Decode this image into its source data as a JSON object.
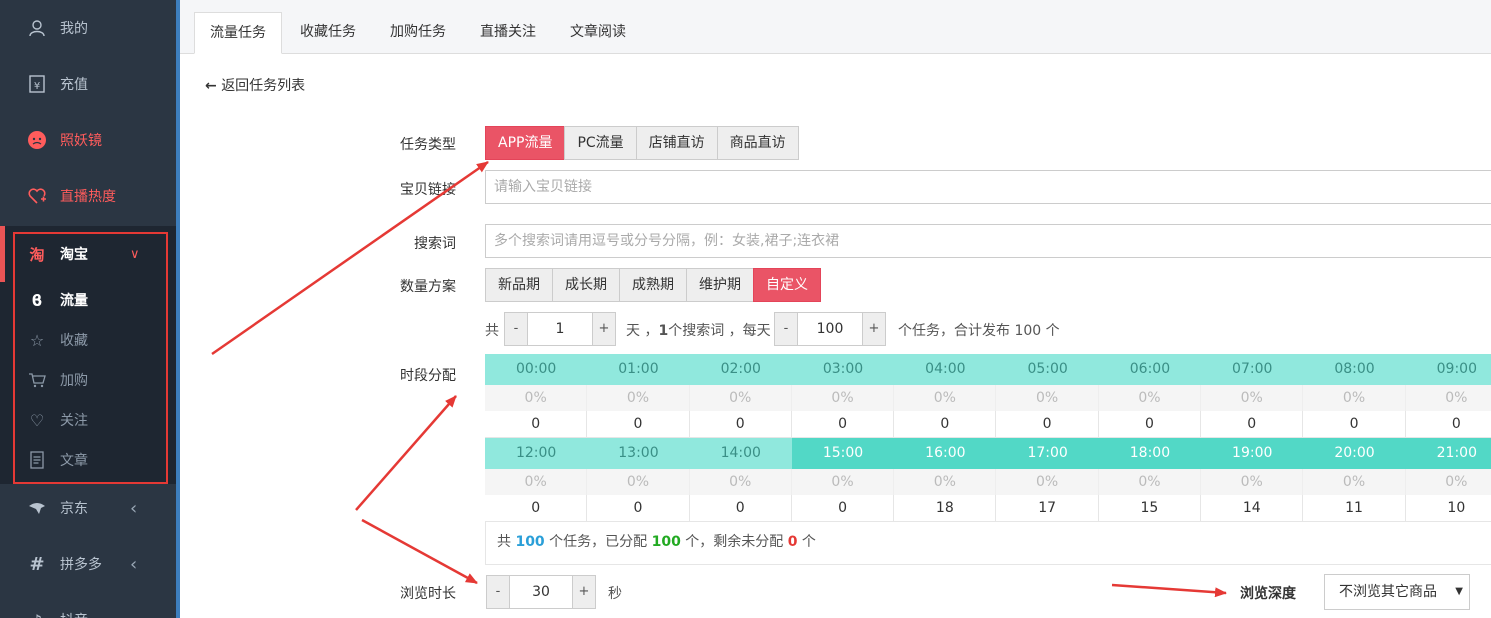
{
  "sidebar": {
    "top_items": [
      {
        "label": "我的",
        "icon": "user-icon"
      },
      {
        "label": "充值",
        "icon": "wallet-icon"
      },
      {
        "label": "照妖镜",
        "icon": "face-icon"
      },
      {
        "label": "直播热度",
        "icon": "heart-plus-icon"
      }
    ],
    "taobao": {
      "label": "淘宝",
      "icon": "taobao-icon",
      "chevron": "∨"
    },
    "sub_items": [
      {
        "label": "流量",
        "icon": "traffic-icon"
      },
      {
        "label": "收藏",
        "icon": "star-icon"
      },
      {
        "label": "加购",
        "icon": "cart-icon"
      },
      {
        "label": "关注",
        "icon": "heart-icon"
      },
      {
        "label": "文章",
        "icon": "article-icon"
      }
    ],
    "bottom_items": [
      {
        "label": "京东",
        "icon": "jd-icon",
        "chevron": "‹"
      },
      {
        "label": "拼多多",
        "icon": "pdd-icon",
        "chevron": "‹"
      },
      {
        "label": "抖音",
        "icon": "douyin-icon"
      }
    ]
  },
  "tabs": [
    "流量任务",
    "收藏任务",
    "加购任务",
    "直播关注",
    "文章阅读"
  ],
  "back_label": "返回任务列表",
  "form": {
    "task_type_label": "任务类型",
    "task_types": [
      "APP流量",
      "PC流量",
      "店铺直访",
      "商品直访"
    ],
    "link_label": "宝贝链接",
    "link_placeholder": "请输入宝贝链接",
    "keyword_label": "搜索词",
    "keyword_placeholder": "多个搜索词请用逗号或分号分隔，例：女装,裙子;连衣裙",
    "qty_label": "数量方案",
    "qty_plans": [
      "新品期",
      "成长期",
      "成熟期",
      "维护期",
      "自定义"
    ],
    "plan_text_1": "共",
    "days_value": "1",
    "plan_text_2": "天 ，",
    "plan_text_3": "1",
    "plan_text_4": "个搜索词 ，每天",
    "per_day_value": "100",
    "plan_text_5": "个任务，合计发布 100 个",
    "minus": "-",
    "plus": "+",
    "time_label": "时段分配",
    "time_rows": [
      {
        "hours": [
          "00:00",
          "01:00",
          "02:00",
          "03:00",
          "04:00",
          "05:00",
          "06:00",
          "07:00",
          "08:00",
          "09:00"
        ],
        "pcts": [
          "0%",
          "0%",
          "0%",
          "0%",
          "0%",
          "0%",
          "0%",
          "0%",
          "0%",
          "0%"
        ],
        "nums": [
          "0",
          "0",
          "0",
          "0",
          "0",
          "0",
          "0",
          "0",
          "0",
          "0"
        ]
      },
      {
        "hours": [
          "12:00",
          "13:00",
          "14:00",
          "15:00",
          "16:00",
          "17:00",
          "18:00",
          "19:00",
          "20:00",
          "21:00"
        ],
        "pcts": [
          "0%",
          "0%",
          "0%",
          "0%",
          "0%",
          "0%",
          "0%",
          "0%",
          "0%",
          "0%"
        ],
        "nums": [
          "0",
          "0",
          "0",
          "0",
          "18",
          "17",
          "15",
          "14",
          "11",
          "10"
        ]
      }
    ],
    "summary": {
      "t1": "共 ",
      "total": "100",
      "t2": " 个任务，已分配 ",
      "assigned": "100",
      "t3": " 个，剩余未分配 ",
      "remaining": "0",
      "t4": " 个"
    },
    "browse_time_label": "浏览时长",
    "browse_time_value": "30",
    "browse_time_unit": "秒",
    "browse_depth_label": "浏览深度",
    "browse_depth_value": "不浏览其它商品"
  },
  "colors": {
    "accent_red": "#ea5466",
    "teal_light": "#90e8dd",
    "teal_dark": "#52d8c6",
    "sidebar_bg": "#2b3643",
    "annotation_red": "#e53935"
  }
}
